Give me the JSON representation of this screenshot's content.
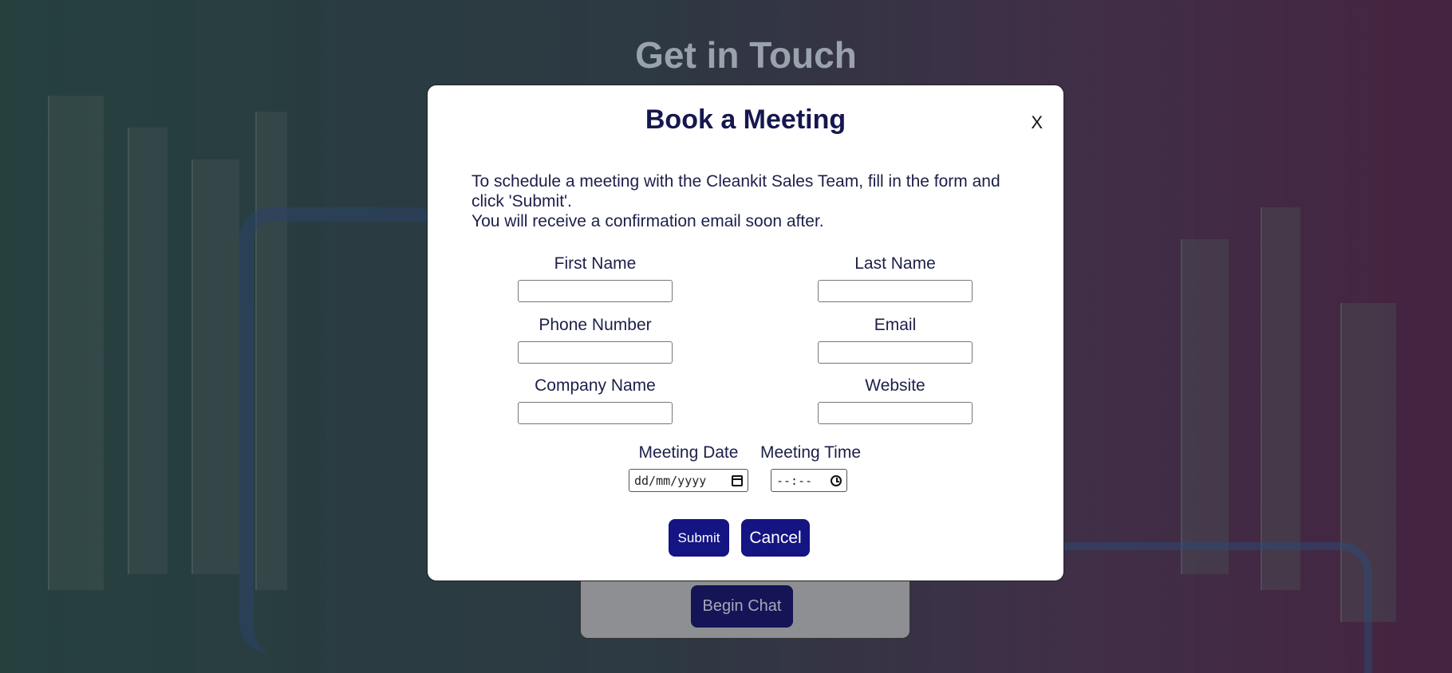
{
  "page": {
    "title": "Get in Touch",
    "chat_button": "Begin Chat"
  },
  "modal": {
    "title": "Book a Meeting",
    "close_label": "X",
    "intro_line1": "To schedule a meeting with the Cleankit Sales Team, fill in the form and click 'Submit'.",
    "intro_line2": "You will receive a confirmation email soon after.",
    "fields": {
      "first_name": "First Name",
      "last_name": "Last Name",
      "phone": "Phone Number",
      "email": "Email",
      "company": "Company Name",
      "website": "Website",
      "meeting_date": "Meeting Date",
      "meeting_time": "Meeting Time"
    },
    "date_placeholder": "dd/mm/yyyy",
    "time_placeholder": "--:--",
    "submit_label": "Submit",
    "cancel_label": "Cancel"
  },
  "icons": {
    "date": "calendar-icon",
    "time": "clock-icon"
  },
  "colors": {
    "button_bg": "#141483",
    "title_color": "#15174f",
    "chat_button_bg": "#141457"
  }
}
